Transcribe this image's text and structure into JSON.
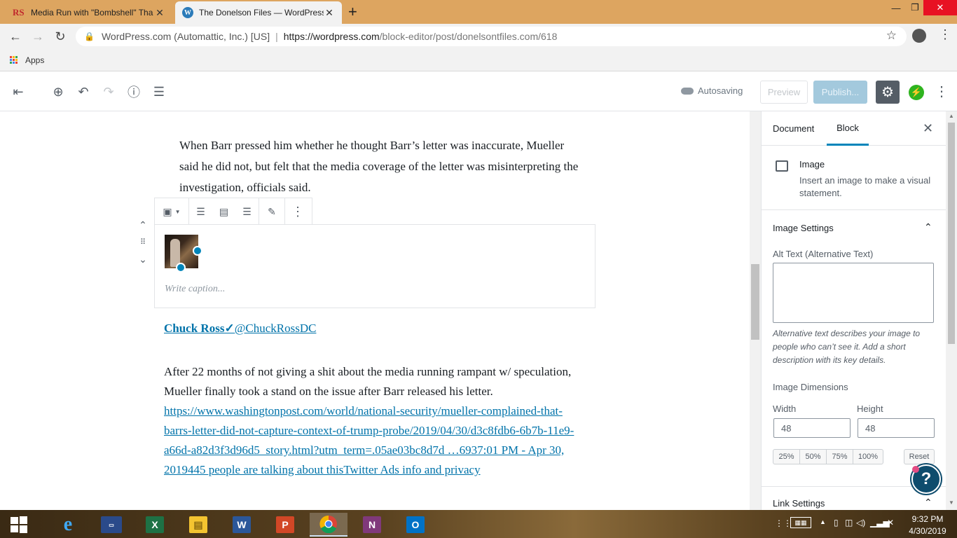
{
  "browser": {
    "tabs": [
      {
        "favicon": "RS",
        "title": "Media Run with \"Bombshell\" Tha",
        "close": "✕"
      },
      {
        "favicon": "W",
        "title": "The Donelson Files — WordPress",
        "close": "✕"
      }
    ],
    "new_tab": "+",
    "window_controls": {
      "minimize": "—",
      "maximize": "❐",
      "close": "✕"
    },
    "nav": {
      "back": "←",
      "forward": "→",
      "reload": "↻"
    },
    "site_identity": "WordPress.com (Automattic, Inc.) [US]",
    "url_host": "https://wordpress.com",
    "url_path": "/block-editor/post/donelsontfiles.com/618",
    "bookmarks": {
      "apps_label": "Apps"
    }
  },
  "editor_header": {
    "icons": [
      "exit-icon",
      "add-block-icon",
      "undo-icon",
      "redo-icon",
      "info-icon",
      "outline-icon"
    ],
    "autosave_label": "Autosaving",
    "preview_label": "Preview",
    "publish_label": "Publish...",
    "settings_icon": "gear-icon",
    "jetpack_icon": "jetpack-icon",
    "more_icon": "vertical-ellipsis-icon"
  },
  "content": {
    "paragraph_top": "When Barr pressed him whether he thought Barr’s letter was inaccurate, Mueller said he did not, but felt that the media coverage of the letter was misinterpreting the investigation, officials said.",
    "image_caption_placeholder": "Write caption...",
    "image": {
      "width": 48,
      "height": 48
    },
    "tweet_author": "Chuck Ross✓",
    "tweet_handle": "@ChuckRossDC",
    "paragraph_body": "After 22 months of not giving a shit about the media running rampant w/ speculation, Mueller finally took a stand on the issue after Barr released his letter.",
    "paragraph_link": "https://www.washingtonpost.com/world/national-security/mueller-complained-that-barrs-letter-did-not-capture-context-of-trump-probe/2019/04/30/d3c8fdb6-6b7b-11e9-a66d-a82d3f3d96d5_story.html?utm_term=.05ae03bc8d7d …6937:01 PM - Apr 30, 2019445 people are talking about thisTwitter Ads info and privacy"
  },
  "sidebar": {
    "tab_document": "Document",
    "tab_block": "Block",
    "close": "✕",
    "block_title": "Image",
    "block_desc": "Insert an image to make a visual statement.",
    "image_settings_title": "Image Settings",
    "alt_text_label": "Alt Text (Alternative Text)",
    "alt_text_value": "",
    "alt_help": "Alternative text describes your image to people who can’t see it. Add a short description with its key details.",
    "dimensions_label": "Image Dimensions",
    "width_label": "Width",
    "height_label": "Height",
    "width_value": "48",
    "height_value": "48",
    "percent_buttons": [
      "25%",
      "50%",
      "75%",
      "100%"
    ],
    "reset_label": "Reset",
    "link_settings_title": "Link Settings",
    "help_label": "?"
  },
  "taskbar": {
    "apps": [
      "windows-start-icon",
      "internet-explorer-icon",
      "lenovo-icon",
      "excel-icon",
      "file-explorer-icon",
      "word-icon",
      "powerpoint-icon",
      "chrome-icon",
      "onenote-icon",
      "outlook-icon"
    ],
    "clock_time": "9:32 PM",
    "clock_date": "4/30/2019"
  },
  "colors": {
    "tabstrip": "#dda560",
    "accent": "#0085ba",
    "link": "#0073aa",
    "publish_disabled": "#a3c9dd",
    "settings_active": "#555d66",
    "jetpack_green": "#2fb41f"
  }
}
